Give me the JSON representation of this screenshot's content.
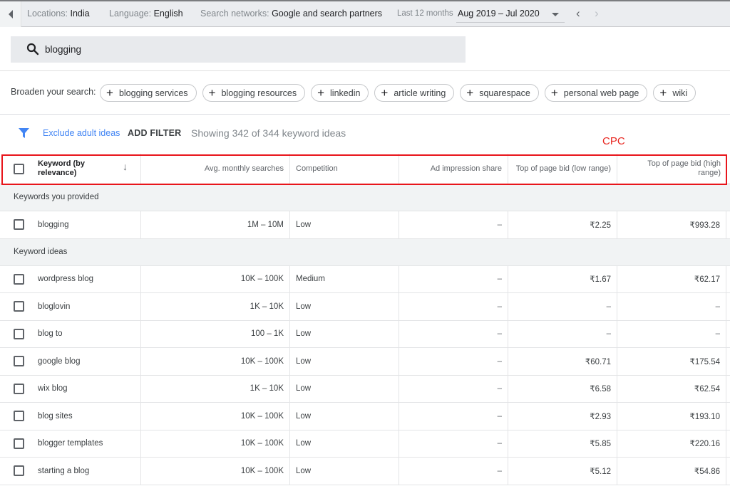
{
  "topbar": {
    "locations_label": "Locations:",
    "locations_value": "India",
    "language_label": "Language:",
    "language_value": "English",
    "networks_label": "Search networks:",
    "networks_value": "Google and search partners",
    "period_label": "Last 12 months",
    "date_range": "Aug 2019 – Jul 2020",
    "prev_arrow": "‹",
    "next_arrow": "›"
  },
  "search": {
    "value": "blogging",
    "icon": "search-icon"
  },
  "broaden": {
    "label": "Broaden your search:",
    "chips": [
      "blogging services",
      "blogging resources",
      "linkedin",
      "article writing",
      "squarespace",
      "personal web page",
      "wiki"
    ]
  },
  "filters": {
    "exclude_adult": "Exclude adult ideas",
    "add_filter": "ADD FILTER",
    "showing": "Showing 342 of 344 keyword ideas"
  },
  "annotation": {
    "cpc_label": "CPC",
    "highlight_color": "#e8151b"
  },
  "table": {
    "columns": [
      "Keyword (by relevance)",
      "Avg. monthly searches",
      "Competition",
      "Ad impression share",
      "Top of page bid (low range)",
      "Top of page bid (high range)"
    ],
    "groups": [
      {
        "title": "Keywords you provided",
        "rows": [
          {
            "keyword": "blogging",
            "searches": "1M – 10M",
            "competition": "Low",
            "impression_share": "–",
            "bid_low": "₹2.25",
            "bid_high": "₹993.28"
          }
        ]
      },
      {
        "title": "Keyword ideas",
        "rows": [
          {
            "keyword": "wordpress blog",
            "searches": "10K – 100K",
            "competition": "Medium",
            "impression_share": "–",
            "bid_low": "₹1.67",
            "bid_high": "₹62.17"
          },
          {
            "keyword": "bloglovin",
            "searches": "1K – 10K",
            "competition": "Low",
            "impression_share": "–",
            "bid_low": "–",
            "bid_high": "–"
          },
          {
            "keyword": "blog to",
            "searches": "100 – 1K",
            "competition": "Low",
            "impression_share": "–",
            "bid_low": "–",
            "bid_high": "–"
          },
          {
            "keyword": "google blog",
            "searches": "10K – 100K",
            "competition": "Low",
            "impression_share": "–",
            "bid_low": "₹60.71",
            "bid_high": "₹175.54"
          },
          {
            "keyword": "wix blog",
            "searches": "1K – 10K",
            "competition": "Low",
            "impression_share": "–",
            "bid_low": "₹6.58",
            "bid_high": "₹62.54"
          },
          {
            "keyword": "blog sites",
            "searches": "10K – 100K",
            "competition": "Low",
            "impression_share": "–",
            "bid_low": "₹2.93",
            "bid_high": "₹193.10"
          },
          {
            "keyword": "blogger templates",
            "searches": "10K – 100K",
            "competition": "Low",
            "impression_share": "–",
            "bid_low": "₹5.85",
            "bid_high": "₹220.16"
          },
          {
            "keyword": "starting a blog",
            "searches": "10K – 100K",
            "competition": "Low",
            "impression_share": "–",
            "bid_low": "₹5.12",
            "bid_high": "₹54.86"
          }
        ]
      }
    ]
  }
}
